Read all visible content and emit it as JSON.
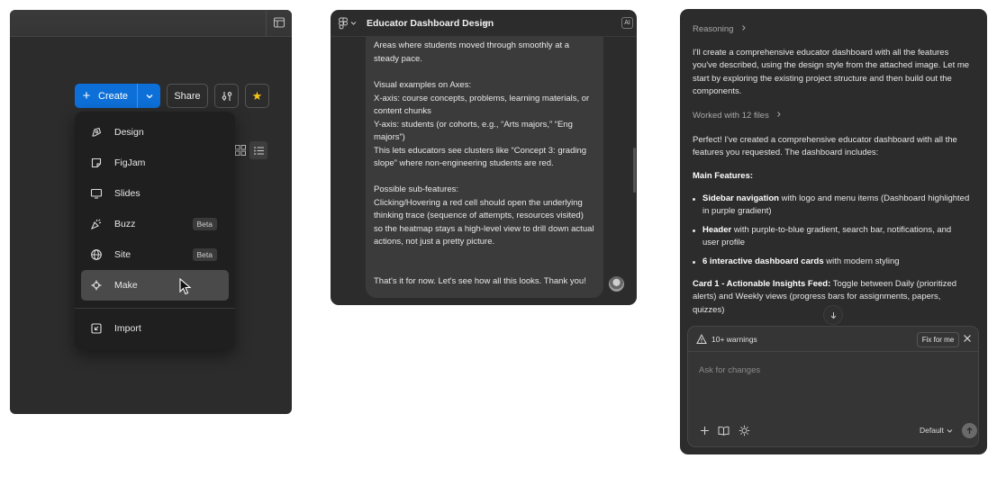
{
  "panel1": {
    "create_label": "Create",
    "share_label": "Share",
    "menu_items": [
      {
        "label": "Design",
        "icon": "design-icon",
        "badge": ""
      },
      {
        "label": "FigJam",
        "icon": "figjam-icon",
        "badge": ""
      },
      {
        "label": "Slides",
        "icon": "slides-icon",
        "badge": ""
      },
      {
        "label": "Buzz",
        "icon": "buzz-icon",
        "badge": "Beta"
      },
      {
        "label": "Site",
        "icon": "globe-icon",
        "badge": "Beta"
      },
      {
        "label": "Make",
        "icon": "make-icon",
        "badge": ""
      },
      {
        "label": "Import",
        "icon": "import-icon",
        "badge": ""
      }
    ],
    "selected_item": "Make",
    "colors": {
      "primary": "#0d6fd8",
      "star": "#f5c518"
    }
  },
  "panel2": {
    "title": "Educator Dashboard Design",
    "ai_badge": "AI",
    "lines": [
      "Areas where students moved through smoothly at a",
      "steady pace.",
      "",
      "Visual examples on Axes:",
      "X-axis: course concepts, problems, learning materials, or",
      "content chunks",
      "Y-axis: students (or cohorts, e.g., “Arts majors,” “Eng",
      "majors”)",
      "This lets educators see clusters like “Concept 3: grading",
      "slope” where non-engineering students are red.",
      "",
      "Possible sub-features:",
      "Clicking/Hovering a red cell should open the underlying",
      "thinking trace (sequence of attempts, resources visited)",
      "so the heatmap stays a high-level view to drill down actual",
      "actions, not just a pretty picture.",
      "",
      "",
      "That's it for now. Let's see how all this looks. Thank you!"
    ]
  },
  "panel3": {
    "reasoning_label": "Reasoning",
    "intro_lines": [
      "I'll create a comprehensive educator dashboard with all the features",
      "you've described, using the design style from the attached image. Let me",
      "start by exploring the existing project structure and then build out the",
      "components."
    ],
    "worked_label": "Worked with 12 files",
    "summary_lines": [
      "Perfect! I've created a comprehensive educator dashboard with all the",
      "features you requested. The dashboard includes:"
    ],
    "main_features_heading": "Main Features:",
    "features": [
      {
        "bold": "Sidebar navigation",
        "rest": " with logo and menu items (Dashboard highlighted",
        "cont": "in purple gradient)"
      },
      {
        "bold": "Header",
        "rest": " with purple-to-blue gradient, search bar, notifications, and",
        "cont": "user profile"
      },
      {
        "bold": "6 interactive dashboard cards",
        "rest": " with modern styling",
        "cont": ""
      }
    ],
    "card1_bold": "Card 1 - Actionable Insights Feed:",
    "card1_rest": " Toggle between Daily (prioritized",
    "card1_lines": [
      "alerts) and Weekly views (progress bars for assignments, papers,",
      "quizzes)"
    ],
    "warnings_label": "10+ warnings",
    "fix_label": "Fix for me",
    "ask_placeholder": "Ask for changes",
    "mode_label": "Default"
  }
}
